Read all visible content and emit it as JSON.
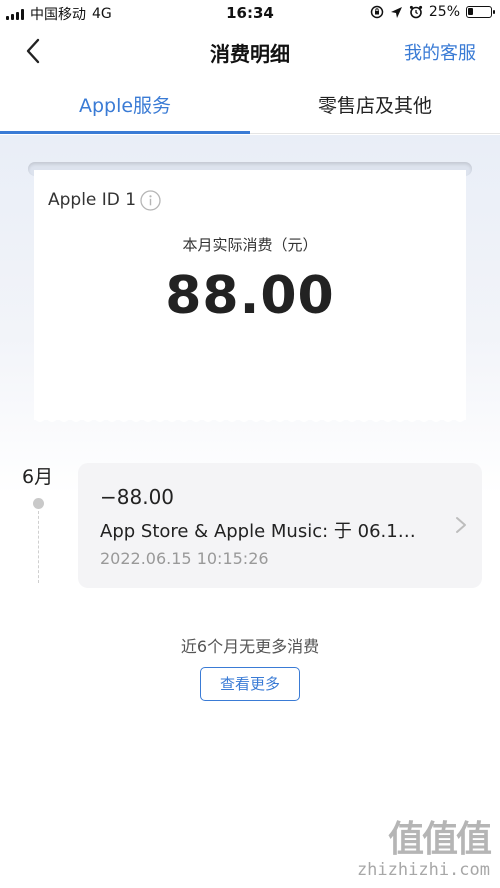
{
  "status_bar": {
    "carrier": "中国移动",
    "network": "4G",
    "time": "16:34",
    "battery": "25%",
    "battery_level": 0.25
  },
  "nav": {
    "title": "消费明细",
    "right_link": "我的客服"
  },
  "tabs": [
    {
      "label": "Apple服务",
      "active": true
    },
    {
      "label": "零售店及其他",
      "active": false
    }
  ],
  "summary": {
    "account": "Apple ID 1",
    "label": "本月实际消费（元）",
    "amount": "88.00"
  },
  "transactions": {
    "month": "6月",
    "items": [
      {
        "amount": "−88.00",
        "description": "App Store & Apple Music: 于 06.1…",
        "time": "2022.06.15 10:15:26"
      }
    ]
  },
  "footer": {
    "no_more_text": "近6个月无更多消费",
    "more_button": "查看更多"
  },
  "watermark": {
    "site": "zhizhizhi.com"
  },
  "colors": {
    "accent": "#3a7bd5",
    "card_bg": "#f4f4f6",
    "muted_text": "#999999"
  }
}
